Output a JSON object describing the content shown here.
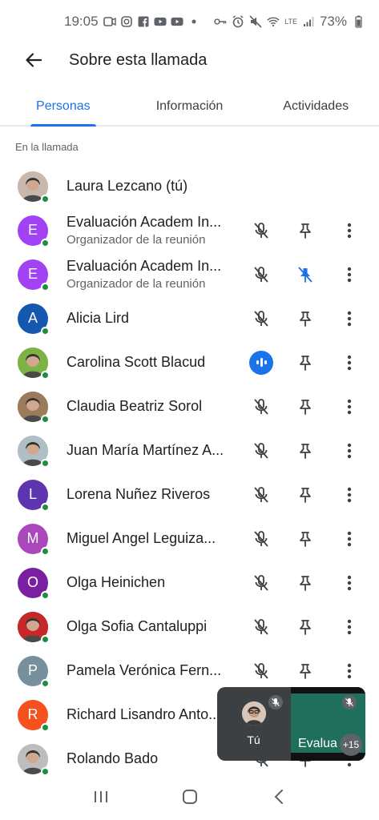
{
  "status_bar": {
    "time": "19:05",
    "network": "LTE",
    "battery": "73%",
    "left_icons": [
      "video-camera-icon",
      "instagram-icon",
      "facebook-icon",
      "youtube-icon",
      "youtube-icon",
      "dot-icon"
    ],
    "right_icons": [
      "key-icon",
      "alarm-icon",
      "mute-icon",
      "wifi-icon",
      "signal-icon"
    ]
  },
  "app_bar": {
    "title": "Sobre esta llamada"
  },
  "tabs": [
    {
      "label": "Personas",
      "active": true
    },
    {
      "label": "Información",
      "active": false
    },
    {
      "label": "Actividades",
      "active": false
    }
  ],
  "section_label": "En la llamada",
  "participants": [
    {
      "name": "Laura Lezcano (tú)",
      "initial": "",
      "avatar_color": "#c9b8ae",
      "photo": true,
      "subtitle": "",
      "mic": "none",
      "pin": "none"
    },
    {
      "name": "Evaluación Academ In...",
      "initial": "E",
      "avatar_color": "#a142f4",
      "photo": false,
      "subtitle": "Organizador de la reunión",
      "mic": "muted",
      "pin": "unpinned"
    },
    {
      "name": "Evaluación Academ In...",
      "initial": "E",
      "avatar_color": "#a142f4",
      "photo": false,
      "subtitle": "Organizador de la reunión",
      "mic": "muted",
      "pin": "pinned"
    },
    {
      "name": "Alicia Lird",
      "initial": "A",
      "avatar_color": "#1558b0",
      "photo": false,
      "subtitle": "",
      "mic": "muted",
      "pin": "unpinned"
    },
    {
      "name": "Carolina Scott Blacud",
      "initial": "",
      "avatar_color": "#7cb342",
      "photo": true,
      "subtitle": "",
      "mic": "speaking",
      "pin": "unpinned"
    },
    {
      "name": "Claudia Beatriz Sorol",
      "initial": "",
      "avatar_color": "#9c7b5b",
      "photo": true,
      "subtitle": "",
      "mic": "muted",
      "pin": "unpinned"
    },
    {
      "name": "Juan María Martínez A...",
      "initial": "",
      "avatar_color": "#b0bec5",
      "photo": true,
      "subtitle": "",
      "mic": "muted",
      "pin": "unpinned"
    },
    {
      "name": "Lorena Nuñez Riveros",
      "initial": "L",
      "avatar_color": "#5e35b1",
      "photo": false,
      "subtitle": "",
      "mic": "muted",
      "pin": "unpinned"
    },
    {
      "name": "Miguel Angel Leguiza...",
      "initial": "M",
      "avatar_color": "#ab47bc",
      "photo": false,
      "subtitle": "",
      "mic": "muted",
      "pin": "unpinned"
    },
    {
      "name": "Olga Heinichen",
      "initial": "O",
      "avatar_color": "#7b1fa2",
      "photo": false,
      "subtitle": "",
      "mic": "muted",
      "pin": "unpinned"
    },
    {
      "name": "Olga Sofia Cantaluppi",
      "initial": "",
      "avatar_color": "#c62828",
      "photo": true,
      "subtitle": "",
      "mic": "muted",
      "pin": "unpinned"
    },
    {
      "name": "Pamela Verónica Fern...",
      "initial": "P",
      "avatar_color": "#78909c",
      "photo": false,
      "subtitle": "",
      "mic": "muted",
      "pin": "unpinned"
    },
    {
      "name": "Richard Lisandro Anto...",
      "initial": "R",
      "avatar_color": "#f4511e",
      "photo": false,
      "subtitle": "",
      "mic": "muted",
      "pin": "unpinned"
    },
    {
      "name": "Rolando Bado",
      "initial": "",
      "avatar_color": "#bdbdbd",
      "photo": true,
      "subtitle": "",
      "mic": "muted",
      "pin": "unpinned"
    }
  ],
  "pip": {
    "self_label": "Tú",
    "screen_label": "Evalua",
    "overflow_count": "+15"
  },
  "nav_bar": {
    "icons": [
      "recents-icon",
      "home-icon",
      "back-nav-icon"
    ]
  },
  "colors": {
    "accent": "#1a73e8",
    "presence": "#1e8e3e",
    "muted_icon": "#3c4043"
  }
}
